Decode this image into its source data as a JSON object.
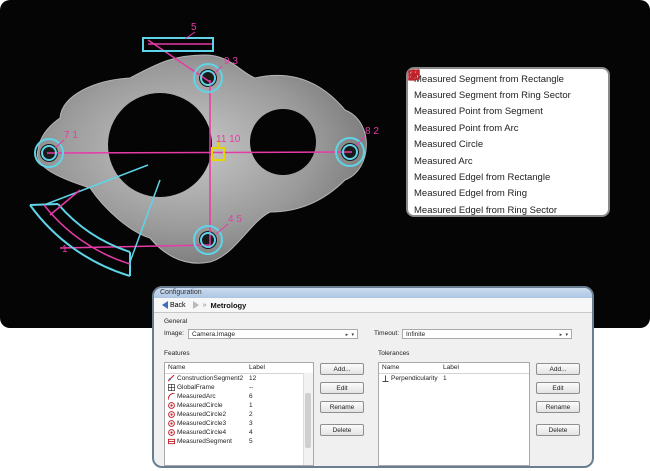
{
  "camera": {
    "annotations": [
      "5",
      "9 3",
      "7 1",
      "8 2",
      "11 10",
      "4 5",
      "1"
    ]
  },
  "legend": {
    "items": [
      {
        "label": "Measured Segment from Rectangle",
        "icon": "segment-rectangle-icon"
      },
      {
        "label": "Measured Segment from Ring Sector",
        "icon": "segment-ring-sector-icon"
      },
      {
        "label": "Measured Point from Segment",
        "icon": "point-segment-icon"
      },
      {
        "label": "Measured Point from Arc",
        "icon": "point-arc-icon"
      },
      {
        "label": "Measured Circle",
        "icon": "circle-icon"
      },
      {
        "label": "Measured Arc",
        "icon": "arc-icon"
      },
      {
        "label": "Measured Edgel from Rectangle",
        "icon": "edgel-rectangle-icon"
      },
      {
        "label": "Measured Edgel from Ring",
        "icon": "edgel-ring-icon"
      },
      {
        "label": "Measured Edgel from Ring Sector",
        "icon": "edgel-ring-sector-icon"
      }
    ]
  },
  "config": {
    "window_title": "Configuration",
    "back_label": "Back",
    "breadcrumb_sep": "»",
    "page_title": "Metrology",
    "general_label": "General",
    "image_label": "Image:",
    "image_value": "Camera.Image",
    "timeout_label": "Timeout:",
    "timeout_value": "Infinite",
    "features": {
      "title": "Features",
      "columns": [
        "Name",
        "Label"
      ],
      "rows": [
        {
          "name": "ConstructionSegment2",
          "label": "12",
          "icon": "construction-segment-icon"
        },
        {
          "name": "GlobalFrame",
          "label": "--",
          "icon": "frame-icon"
        },
        {
          "name": "MeasuredArc",
          "label": "6",
          "icon": "arc-icon"
        },
        {
          "name": "MeasuredCircle",
          "label": "1",
          "icon": "circle-icon"
        },
        {
          "name": "MeasuredCircle2",
          "label": "2",
          "icon": "circle-icon"
        },
        {
          "name": "MeasuredCircle3",
          "label": "3",
          "icon": "circle-icon"
        },
        {
          "name": "MeasuredCircle4",
          "label": "4",
          "icon": "circle-icon"
        },
        {
          "name": "MeasuredSegment",
          "label": "5",
          "icon": "segment-icon"
        }
      ],
      "buttons": [
        "Add...",
        "Edit",
        "Rename",
        "Delete"
      ]
    },
    "tolerances": {
      "title": "Tolerances",
      "columns": [
        "Name",
        "Label"
      ],
      "rows": [
        {
          "name": "Perpendicularity",
          "label": "1",
          "icon": "perpendicularity-icon"
        }
      ],
      "buttons": [
        "Add...",
        "Edit",
        "Rename",
        "Delete"
      ]
    }
  },
  "colors": {
    "cyan": "#5fd4e8",
    "magenta": "#e63aa7",
    "yellow": "#e6d400",
    "icon_red": "#c0202a"
  }
}
